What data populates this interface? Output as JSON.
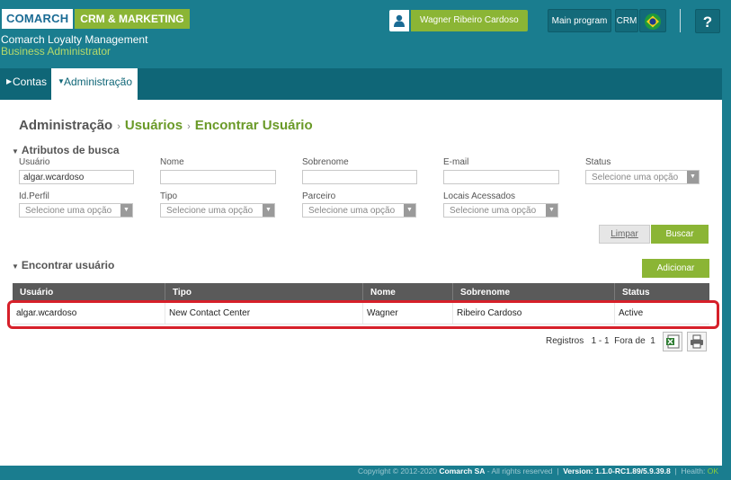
{
  "header": {
    "brand": "COMARCH",
    "product": "CRM & MARKETING",
    "app_title": "Comarch Loyalty Management",
    "role": "Business Administrator",
    "user_name": "Wagner Ribeiro Cardoso",
    "main_program_label": "Main program",
    "crm_label": "CRM",
    "help_label": "?"
  },
  "nav": {
    "items": [
      {
        "label": "Contas"
      },
      {
        "label": "Administração"
      }
    ]
  },
  "breadcrumb": {
    "root": "Administração",
    "level1": "Usuários",
    "level2": "Encontrar Usuário"
  },
  "search": {
    "section_title": "Atributos de busca",
    "fields": {
      "usuario": {
        "label": "Usuário",
        "value": "algar.wcardoso"
      },
      "nome": {
        "label": "Nome",
        "value": ""
      },
      "sobrenome": {
        "label": "Sobrenome",
        "value": ""
      },
      "email": {
        "label": "E-mail",
        "value": ""
      },
      "status": {
        "label": "Status",
        "value": "Selecione uma opção"
      },
      "id_perfil": {
        "label": "Id.Perfil",
        "value": "Selecione uma opção"
      },
      "tipo": {
        "label": "Tipo",
        "value": "Selecione uma opção"
      },
      "parceiro": {
        "label": "Parceiro",
        "value": "Selecione uma opção"
      },
      "locais": {
        "label": "Locais Acessados",
        "value": "Selecione uma opção"
      }
    },
    "clear_label": "Limpar",
    "search_label": "Buscar"
  },
  "results": {
    "section_title": "Encontrar usuário",
    "add_label": "Adicionar",
    "columns": [
      "Usuário",
      "Tipo",
      "Nome",
      "Sobrenome",
      "Status"
    ],
    "rows": [
      {
        "usuario": "algar.wcardoso",
        "tipo": "New Contact Center",
        "nome": "Wagner",
        "sobrenome": "Ribeiro Cardoso",
        "status": "Active"
      }
    ],
    "records_label": "Registros",
    "records_range": "1 - 1",
    "records_of": "Fora de",
    "records_total": "1"
  },
  "footer": {
    "copyright_prefix": "Copyright © 2012-2020",
    "company": "Comarch SA",
    "rights": "- All rights reserved",
    "version_label": "Version:",
    "version": "1.1.0-RC1.89/5.9.39.8",
    "health_label": "Health:",
    "health_value": "OK"
  },
  "colors": {
    "primary": "#1a7d8f",
    "accent": "#8bb535",
    "highlight": "#d6202a"
  }
}
